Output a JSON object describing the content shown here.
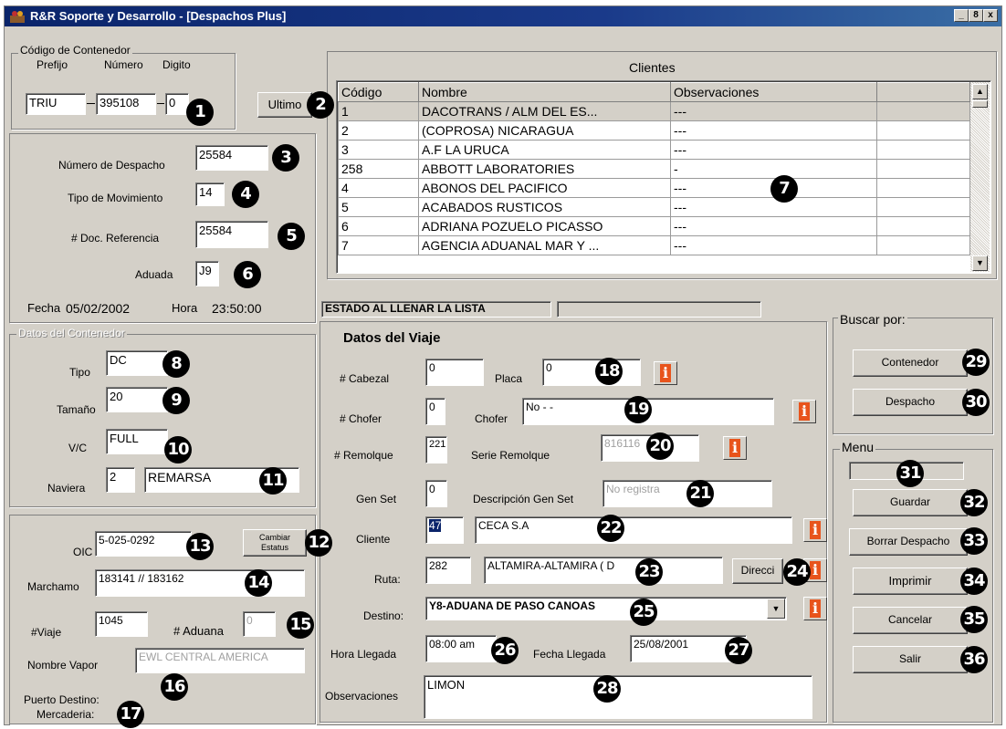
{
  "window": {
    "title": "R&R Soporte y Desarrollo - [Despachos Plus]",
    "min": "_",
    "restore": "8",
    "close": "x"
  },
  "container_code": {
    "group": "Código de Contenedor",
    "prefix_label": "Prefijo",
    "number_label": "Número",
    "digit_label": "Digito",
    "prefix": "TRIU",
    "number": "395108",
    "digit": "0",
    "ultimo_button": "Ultimo"
  },
  "dispatch": {
    "numero_label": "Número de Despacho",
    "numero": "25584",
    "tipo_label": "Tipo de Movimiento",
    "tipo": "14",
    "docref_label": "# Doc. Referencia",
    "docref": "25584",
    "aduana_label": "Aduada",
    "aduana": "J9",
    "fecha_label": "Fecha",
    "fecha": "05/02/2002",
    "hora_label": "Hora",
    "hora": "23:50:00"
  },
  "container_data": {
    "group": "Datos del Contenedor",
    "tipo_label": "Tipo",
    "tipo": "DC",
    "tamano_label": "Tamaño",
    "tamano": "20",
    "vc_label": "V/C",
    "vc": "FULL",
    "naviera_label": "Naviera",
    "naviera_code": "2",
    "naviera_name": "REMARSA"
  },
  "shipping": {
    "oic_label": "OIC",
    "oic": "5-025-0292",
    "cambiar_button_l1": "Cambiar",
    "cambiar_button_l2": "Estatus",
    "marchamo_label": "Marchamo",
    "marchamo": "183141 // 183162",
    "viaje_label": "#Viaje",
    "viaje": "1045",
    "aduana_num_label": "# Aduana",
    "aduana_num": "0",
    "vapor_label": "Nombre Vapor",
    "vapor": "EWL CENTRAL AMERICA",
    "puerto_label": "Puerto Destino:",
    "mercaderia_label": "Mercaderia:"
  },
  "clients": {
    "title": "Clientes",
    "columns": [
      "Código",
      "Nombre",
      "Observaciones",
      ""
    ],
    "rows": [
      [
        "1",
        "DACOTRANS / ALM DEL ES...",
        "---"
      ],
      [
        "2",
        "(COPROSA) NICARAGUA",
        "---"
      ],
      [
        "3",
        "A.F LA URUCA",
        "---"
      ],
      [
        "258",
        "ABBOTT LABORATORIES",
        "-"
      ],
      [
        "4",
        "ABONOS DEL PACIFICO",
        "---"
      ],
      [
        "5",
        "ACABADOS RUSTICOS",
        "---"
      ],
      [
        "6",
        "ADRIANA POZUELO PICASSO",
        "---"
      ],
      [
        "7",
        "AGENCIA ADUANAL MAR Y ...",
        "---"
      ]
    ]
  },
  "status": {
    "label": "ESTADO AL LLENAR LA LISTA"
  },
  "trip": {
    "title": "Datos del Viaje",
    "cabezal_label": "# Cabezal",
    "cabezal": "0",
    "placa_label": "Placa",
    "placa": "0",
    "chofer_num_label": "# Chofer",
    "chofer_num": "0",
    "chofer_label": "Chofer",
    "chofer": "No - -",
    "remolque_label": "# Remolque",
    "remolque": "221",
    "serie_label": "Serie Remolque",
    "serie": "816116",
    "genset_label": "Gen Set",
    "genset": "0",
    "desc_genset_label": "Descripción Gen Set",
    "desc_genset": "No registra",
    "cliente_label": "Cliente",
    "cliente_code": "47",
    "cliente_name": "CECA S.A",
    "ruta_label": "Ruta:",
    "ruta_code": "282",
    "ruta_name": "ALTAMIRA-ALTAMIRA ( D",
    "ruta_name_tail": "O )",
    "direccion_button": "Direcci",
    "destino_label": "Destino:",
    "destino": "Y8-ADUANA DE PASO CANOAS",
    "hora_llegada_label": "Hora Llegada",
    "hora_llegada": "08:00 am",
    "fecha_llegada_label": "Fecha Llegada",
    "fecha_llegada": "25/08/2001",
    "observaciones_label": "Observaciones",
    "observaciones": "LIMON",
    "info_glyph": "i"
  },
  "search": {
    "group": "Buscar por:",
    "contenedor": "Contenedor",
    "despacho": "Despacho"
  },
  "menu": {
    "group": "Menu",
    "guardar": "Guardar",
    "borrar": "Borrar Despacho",
    "imprimir": "Imprimir",
    "cancelar": "Cancelar",
    "salir": "Salir"
  },
  "markers": [
    "1",
    "2",
    "3",
    "4",
    "5",
    "6",
    "7",
    "8",
    "9",
    "10",
    "11",
    "12",
    "13",
    "14",
    "15",
    "16",
    "17",
    "18",
    "19",
    "20",
    "21",
    "22",
    "23",
    "24",
    "25",
    "26",
    "27",
    "28",
    "29",
    "30",
    "31",
    "32",
    "33",
    "34",
    "35",
    "36"
  ]
}
